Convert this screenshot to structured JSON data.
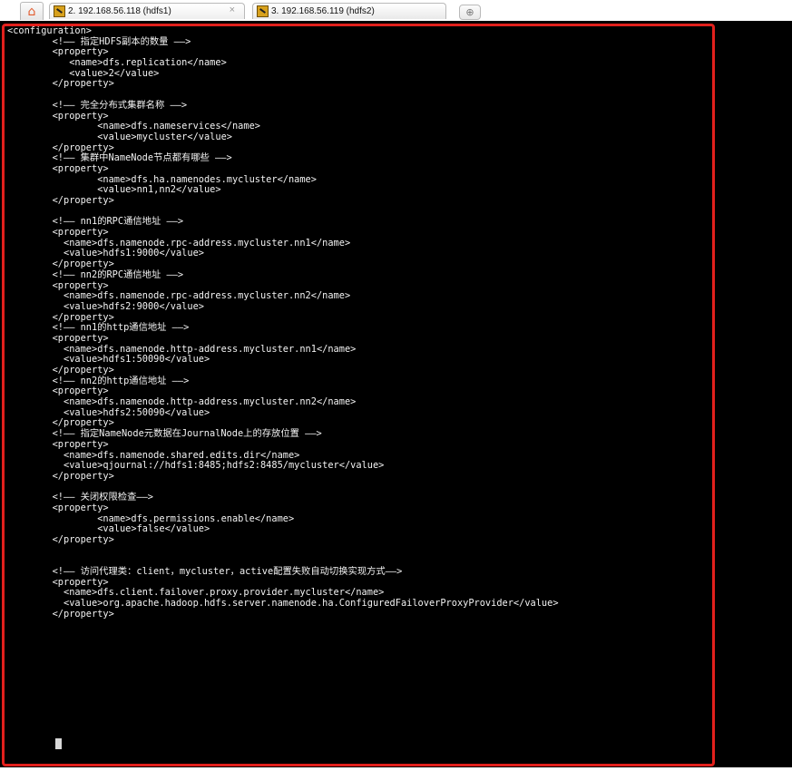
{
  "tabs": [
    {
      "label": "2. 192.168.56.118 (hdfs1)",
      "close": "×"
    },
    {
      "label": "3. 192.168.56.119 (hdfs2)"
    }
  ],
  "home_icon": "home-icon",
  "new_tab_icon": "plus-icon",
  "terminal": {
    "lines": [
      "<configuration>",
      "        <!—— 指定HDFS副本的数量 ——>",
      "        <property>",
      "           <name>dfs.replication</name>",
      "           <value>2</value>",
      "        </property>",
      "",
      "        <!—— 完全分布式集群名称 ——>",
      "        <property>",
      "                <name>dfs.nameservices</name>",
      "                <value>mycluster</value>",
      "        </property>",
      "        <!—— 集群中NameNode节点都有哪些 ——>",
      "        <property>",
      "                <name>dfs.ha.namenodes.mycluster</name>",
      "                <value>nn1,nn2</value>",
      "        </property>",
      "",
      "        <!—— nn1的RPC通信地址 ——>",
      "        <property>",
      "          <name>dfs.namenode.rpc-address.mycluster.nn1</name>",
      "          <value>hdfs1:9000</value>",
      "        </property>",
      "        <!—— nn2的RPC通信地址 ——>",
      "        <property>",
      "          <name>dfs.namenode.rpc-address.mycluster.nn2</name>",
      "          <value>hdfs2:9000</value>",
      "        </property>",
      "        <!—— nn1的http通信地址 ——>",
      "        <property>",
      "          <name>dfs.namenode.http-address.mycluster.nn1</name>",
      "          <value>hdfs1:50090</value>",
      "        </property>",
      "        <!—— nn2的http通信地址 ——>",
      "        <property>",
      "          <name>dfs.namenode.http-address.mycluster.nn2</name>",
      "          <value>hdfs2:50090</value>",
      "        </property>",
      "        <!—— 指定NameNode元数据在JournalNode上的存放位置 ——>",
      "        <property>",
      "          <name>dfs.namenode.shared.edits.dir</name>",
      "          <value>qjournal://hdfs1:8485;hdfs2:8485/mycluster</value>",
      "        </property>",
      "",
      "        <!—— 关闭权限检查——>",
      "        <property>",
      "                <name>dfs.permissions.enable</name>",
      "                <value>false</value>",
      "        </property>",
      "",
      "",
      "        <!—— 访问代理类：client，mycluster，active配置失败自动切换实现方式——>",
      "        <property>",
      "          <name>dfs.client.failover.proxy.provider.mycluster</name>",
      "          <value>org.apache.hadoop.hdfs.server.namenode.ha.ConfiguredFailoverProxyProvider</value>",
      "        </property>"
    ]
  }
}
